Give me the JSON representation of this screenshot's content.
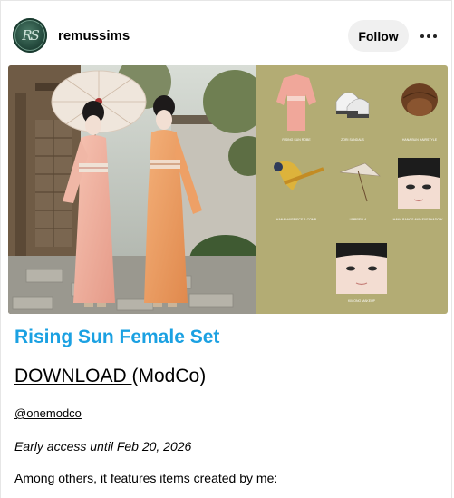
{
  "post": {
    "author": "remussims",
    "avatar_monogram": "RS",
    "follow_label": "Follow",
    "more_icon": "ellipsis-icon",
    "title": "Rising Sun Female Set",
    "download_link": "DOWNLOAD ",
    "download_suffix": "(ModCo)",
    "mention": "@onemodco",
    "early_access": "Early access until Feb 20, 2026",
    "body_text": "Among others, it features items created by me:"
  },
  "image": {
    "catalog_items": [
      "RISING SUN ROBE",
      "ZORI SANDALS",
      "HANA BUN HAIRSTYLE",
      "HANA HAIRPIECE & COMB",
      "UMBRELLA",
      "HANA BANGS AND EYESHADOW",
      "KIMONO MAKEUP"
    ]
  },
  "colors": {
    "title": "#1ba1e2",
    "catalog_bg": "#b3ac74",
    "follow_bg": "#f0f0f0"
  }
}
